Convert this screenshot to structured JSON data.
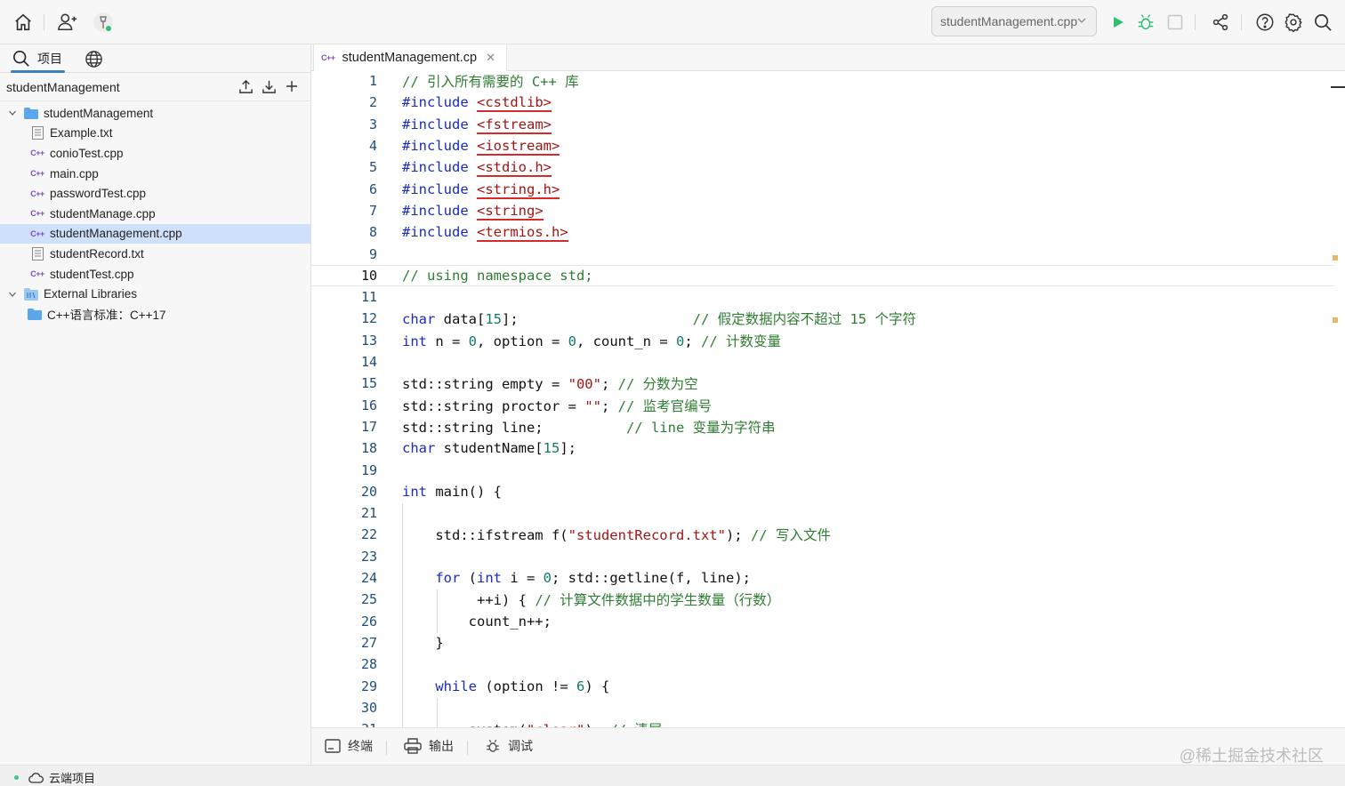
{
  "toolbar": {
    "run_file": "studentManagement.cpp"
  },
  "sidebar": {
    "tabs": [
      {
        "label": "项目"
      },
      {
        "label": ""
      }
    ],
    "project_name": "studentManagement",
    "tree": [
      {
        "label": "studentManagement",
        "type": "folder",
        "expanded": true
      },
      {
        "label": "Example.txt",
        "type": "txt"
      },
      {
        "label": "conioTest.cpp",
        "type": "cpp"
      },
      {
        "label": "main.cpp",
        "type": "cpp"
      },
      {
        "label": "passwordTest.cpp",
        "type": "cpp"
      },
      {
        "label": "studentManage.cpp",
        "type": "cpp"
      },
      {
        "label": "studentManagement.cpp",
        "type": "cpp",
        "selected": true
      },
      {
        "label": "studentRecord.txt",
        "type": "txt"
      },
      {
        "label": "studentTest.cpp",
        "type": "cpp"
      },
      {
        "label": "External Libraries",
        "type": "lib",
        "expanded": true
      },
      {
        "label": "C++语言标准：C++17",
        "type": "folder"
      }
    ]
  },
  "editor": {
    "tab_label": "studentManagement.cp",
    "current_line": 10,
    "lines": [
      "// 引入所有需要的 C++ 库",
      "#include <cstdlib>",
      "#include <fstream>",
      "#include <iostream>",
      "#include <stdio.h>",
      "#include <string.h>",
      "#include <string>",
      "#include <termios.h>",
      "",
      "// using namespace std;",
      "",
      "char data[15];                     // 假定数据内容不超过 15 个字符",
      "int n = 0, option = 0, count_n = 0; // 计数变量",
      "",
      "std::string empty = \"00\"; // 分数为空",
      "std::string proctor = \"\"; // 监考官编号",
      "std::string line;          // line 变量为字符串",
      "char studentName[15];",
      "",
      "int main() {",
      "",
      "    std::ifstream f(\"studentRecord.txt\"); // 写入文件",
      "",
      "    for (int i = 0; std::getline(f, line);",
      "         ++i) { // 计算文件数据中的学生数量（行数）",
      "        count_n++;",
      "    }",
      "",
      "    while (option != 6) {",
      "",
      "        system(\"clear\"); // 清屏"
    ]
  },
  "bottom": {
    "terminal": "终端",
    "output": "输出",
    "debug": "调试"
  },
  "status": {
    "cloud": "云端项目"
  },
  "watermark": "@稀土掘金技术社区"
}
